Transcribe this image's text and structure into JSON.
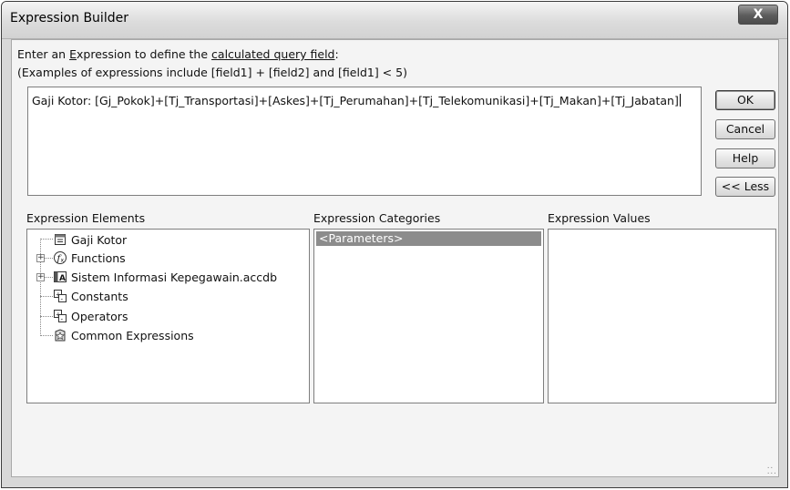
{
  "window": {
    "title": "Expression Builder",
    "close_label": "X"
  },
  "prompt": {
    "line1_prefix": "Enter an ",
    "line1_mnemonic": "E",
    "line1_mid": "xpression to define the ",
    "line1_link": "calculated query field",
    "line1_suffix": ":",
    "line2": "(Examples of expressions include [field1] + [field2] and [field1] < 5)"
  },
  "expression": {
    "value": "Gaji Kotor: [Gj_Pokok]+[Tj_Transportasi]+[Askes]+[Tj_Perumahan]+[Tj_Telekomunikasi]+[Tj_Makan]+[Tj_Jabatan]"
  },
  "buttons": {
    "ok": "OK",
    "cancel": "Cancel",
    "help": "Help",
    "less": "<< Less"
  },
  "panels": {
    "elements_heading": "Expression Elements",
    "categories_heading": "Expression Categories",
    "values_heading": "Expression Values"
  },
  "elements": [
    {
      "label": "Gaji Kotor",
      "icon": "form-icon",
      "expandable": false
    },
    {
      "label": "Functions",
      "icon": "function-icon",
      "expandable": true
    },
    {
      "label": "Sistem Informasi Kepegawain.accdb",
      "icon": "database-icon",
      "expandable": true
    },
    {
      "label": "Constants",
      "icon": "constants-icon",
      "expandable": false
    },
    {
      "label": "Operators",
      "icon": "operators-icon",
      "expandable": false
    },
    {
      "label": "Common Expressions",
      "icon": "common-expressions-icon",
      "expandable": false
    }
  ],
  "categories": [
    {
      "label": "<Parameters>",
      "selected": true
    }
  ],
  "values": []
}
